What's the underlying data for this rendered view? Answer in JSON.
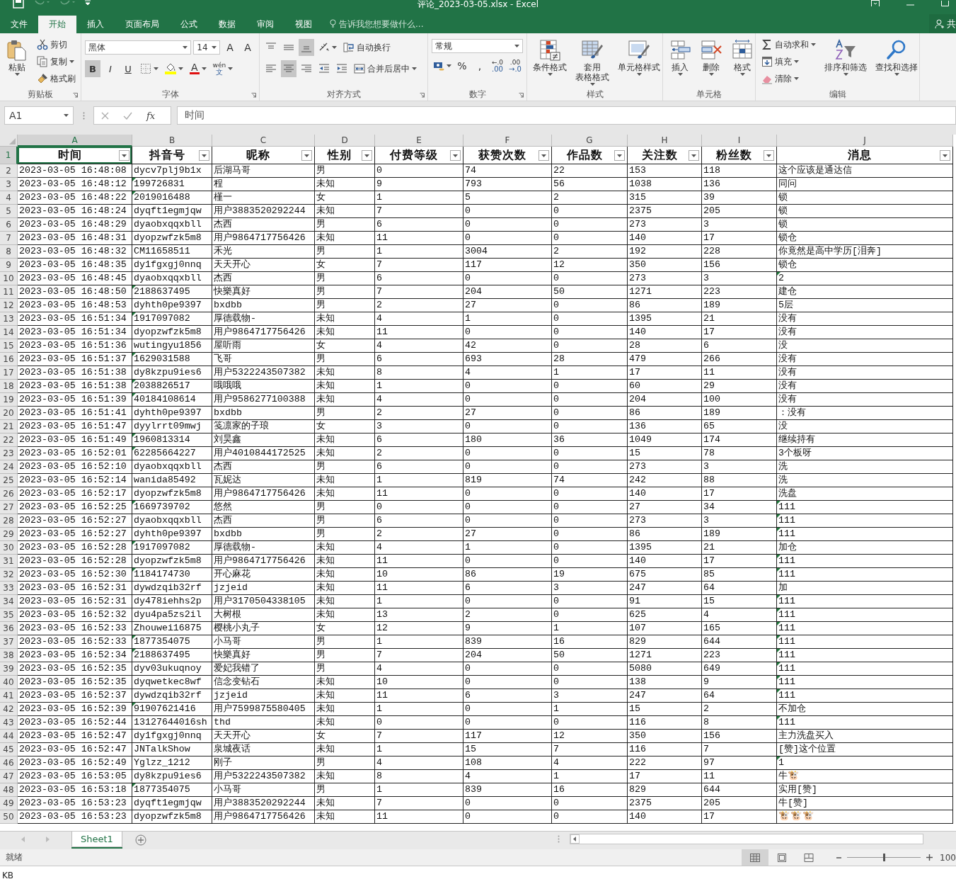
{
  "title_bar": {
    "title": "评论_2023-03-05.xlsx - Excel"
  },
  "ribbon_tabs": [
    {
      "label": "文件",
      "selected": false
    },
    {
      "label": "开始",
      "selected": true
    },
    {
      "label": "插入",
      "selected": false
    },
    {
      "label": "页面布局",
      "selected": false
    },
    {
      "label": "公式",
      "selected": false
    },
    {
      "label": "数据",
      "selected": false
    },
    {
      "label": "审阅",
      "selected": false
    },
    {
      "label": "视图",
      "selected": false
    }
  ],
  "tell_me": {
    "placeholder": "告诉我您想要做什么..."
  },
  "share": "共",
  "ribbon": {
    "groups": [
      {
        "label": "剪贴板",
        "launcher": true,
        "columns": [
          [
            {
              "kind": "large",
              "label": "粘贴",
              "dropdown": true
            }
          ],
          [
            {
              "kind": "small",
              "label": "剪切",
              "dropdown": false
            },
            {
              "kind": "small",
              "label": "复制",
              "dropdown": true
            },
            {
              "kind": "small",
              "label": "格式刷",
              "dropdown": false
            }
          ]
        ]
      },
      {
        "label": "字体",
        "launcher": true,
        "rows": [
          [
            {
              "kind": "combo",
              "value": "黑体"
            },
            {
              "kind": "combo",
              "value": "14"
            },
            {
              "kind": "glyph",
              "label": "A",
              "dropdown": false
            },
            {
              "kind": "glyph",
              "label": "A",
              "dropdown": false
            }
          ],
          [
            {
              "kind": "toggle",
              "label": "B",
              "on": true
            },
            {
              "kind": "toggle",
              "label": "I",
              "on": false
            },
            {
              "kind": "toggle",
              "label": "U",
              "on": false
            },
            {
              "kind": "icon",
              "dropdown": true,
              "on": false
            },
            {
              "kind": "icon",
              "dropdown": true,
              "on": false
            },
            {
              "kind": "color_glyph",
              "label": "A",
              "dropdown": true
            },
            {
              "kind": "stack",
              "top": "wén",
              "label": "文",
              "dropdown": true
            }
          ]
        ]
      },
      {
        "label": "对齐方式",
        "launcher": true,
        "rows": [
          [
            {
              "kind": "icon",
              "dropdown": false,
              "on": false
            },
            {
              "kind": "icon",
              "dropdown": false,
              "on": false
            },
            {
              "kind": "icon",
              "dropdown": false,
              "on": true
            },
            {
              "kind": "icon",
              "dropdown": true,
              "on": false
            },
            {
              "kind": "small",
              "label": "自动换行",
              "dropdown": false
            }
          ],
          [
            {
              "kind": "icon",
              "dropdown": false,
              "on": false
            },
            {
              "kind": "icon",
              "dropdown": false,
              "on": true
            },
            {
              "kind": "icon",
              "dropdown": false,
              "on": false
            },
            {
              "kind": "icon",
              "dropdown": false,
              "on": false
            },
            {
              "kind": "icon",
              "dropdown": false,
              "on": false
            },
            {
              "kind": "small",
              "label": "合并后居中",
              "dropdown": true
            }
          ]
        ]
      },
      {
        "label": "数字",
        "launcher": true,
        "rows": [
          [
            {
              "kind": "combo",
              "value": "常规"
            }
          ],
          [
            {
              "kind": "icon",
              "dropdown": true,
              "on": false
            },
            {
              "kind": "glyph",
              "label": "%",
              "dropdown": false
            },
            {
              "kind": "glyph",
              "label": ",",
              "dropdown": false
            },
            {
              "kind": "stack",
              "top": "←.0",
              "label": ".00",
              "dropdown": false
            },
            {
              "kind": "stack",
              "top": ".00",
              "label": "→.0",
              "dropdown": false
            }
          ]
        ]
      },
      {
        "label": "样式",
        "launcher": false,
        "columns": [
          [
            {
              "kind": "large",
              "label": "条件格式",
              "dropdown": true
            }
          ],
          [
            {
              "kind": "large",
              "lines": [
                "套用",
                "表格格式"
              ],
              "dropdown": true
            }
          ],
          [
            {
              "kind": "large",
              "label": "单元格样式",
              "dropdown": true
            }
          ]
        ]
      },
      {
        "label": "单元格",
        "launcher": false,
        "columns": [
          [
            {
              "kind": "large",
              "label": "插入",
              "dropdown": true
            }
          ],
          [
            {
              "kind": "large",
              "label": "删除",
              "dropdown": true
            }
          ],
          [
            {
              "kind": "large",
              "label": "格式",
              "dropdown": true
            }
          ]
        ]
      },
      {
        "label": "编辑",
        "launcher": false,
        "columns": [
          [
            {
              "kind": "small",
              "label": "自动求和",
              "dropdown": true
            },
            {
              "kind": "small",
              "label": "填充",
              "dropdown": true
            },
            {
              "kind": "small",
              "label": "清除",
              "dropdown": true
            }
          ],
          [
            {
              "kind": "large",
              "label": "排序和筛选",
              "dropdown": true
            }
          ],
          [
            {
              "kind": "large",
              "label": "查找和选择",
              "dropdown": true
            }
          ]
        ]
      }
    ]
  },
  "formula_bar": {
    "name_box": "A1",
    "function_label": "fx",
    "formula": "时间"
  },
  "sheet": {
    "columns": [
      {
        "letter": "A",
        "selected": true
      },
      {
        "letter": "B",
        "selected": false
      },
      {
        "letter": "C",
        "selected": false
      },
      {
        "letter": "D",
        "selected": false
      },
      {
        "letter": "E",
        "selected": false
      },
      {
        "letter": "F",
        "selected": false
      },
      {
        "letter": "G",
        "selected": false
      },
      {
        "letter": "H",
        "selected": false
      },
      {
        "letter": "I",
        "selected": false
      },
      {
        "letter": "J",
        "selected": false
      }
    ],
    "header_row": {
      "number": "1",
      "selected": true,
      "headers": [
        "时间",
        "抖音号",
        "昵称",
        "性别",
        "付费等级",
        "获赞次数",
        "作品数",
        "关注数",
        "粉丝数",
        "消息"
      ]
    },
    "rows": [
      {
        "number": "2",
        "cells": [
          "2023-03-05 16:48:08",
          "dycv7plj9b1x",
          "后湖马哥",
          "男",
          "0",
          "74",
          "22",
          "153",
          "118",
          "这个应该是通达信"
        ],
        "flag_b": false,
        "flag_j": false
      },
      {
        "number": "3",
        "cells": [
          "2023-03-05 16:48:12",
          "199726831",
          "程",
          "未知",
          "9",
          "793",
          "56",
          "1038",
          "136",
          "同问"
        ],
        "flag_b": true,
        "flag_j": false
      },
      {
        "number": "4",
        "cells": [
          "2023-03-05 16:48:22",
          "2019016488",
          "槿一",
          "女",
          "1",
          "5",
          "2",
          "315",
          "39",
          "锁"
        ],
        "flag_b": true,
        "flag_j": false
      },
      {
        "number": "5",
        "cells": [
          "2023-03-05 16:48:24",
          "dyqft1egmjqw",
          "用户3883520292244",
          "未知",
          "7",
          "0",
          "0",
          "2375",
          "205",
          "锁"
        ],
        "flag_b": false,
        "flag_j": false
      },
      {
        "number": "6",
        "cells": [
          "2023-03-05 16:48:29",
          "dyaobxqqxbll",
          "杰西",
          "男",
          "6",
          "0",
          "0",
          "273",
          "3",
          "锁"
        ],
        "flag_b": false,
        "flag_j": false
      },
      {
        "number": "7",
        "cells": [
          "2023-03-05 16:48:31",
          "dyopzwfzk5m8",
          "用户9864717756426",
          "未知",
          "11",
          "0",
          "0",
          "140",
          "17",
          "锁仓"
        ],
        "flag_b": false,
        "flag_j": false
      },
      {
        "number": "8",
        "cells": [
          "2023-03-05 16:48:32",
          "CM11658511",
          "禾光",
          "男",
          "1",
          "3004",
          "2",
          "192",
          "228",
          "你竟然是高中学历[泪奔]"
        ],
        "flag_b": false,
        "flag_j": false
      },
      {
        "number": "9",
        "cells": [
          "2023-03-05 16:48:35",
          "dy1fgxgj0nnq",
          "天天开心",
          "女",
          "7",
          "117",
          "12",
          "350",
          "156",
          "锁仓"
        ],
        "flag_b": false,
        "flag_j": false
      },
      {
        "number": "10",
        "cells": [
          "2023-03-05 16:48:45",
          "dyaobxqqxbll",
          "杰西",
          "男",
          "6",
          "0",
          "0",
          "273",
          "3",
          "2"
        ],
        "flag_b": false,
        "flag_j": true
      },
      {
        "number": "11",
        "cells": [
          "2023-03-05 16:48:50",
          "2188637495",
          "快樂真好",
          "男",
          "7",
          "204",
          "50",
          "1271",
          "223",
          "建仓"
        ],
        "flag_b": true,
        "flag_j": false
      },
      {
        "number": "12",
        "cells": [
          "2023-03-05 16:48:53",
          "dyhth0pe9397",
          "bxdbb",
          "男",
          "2",
          "27",
          "0",
          "86",
          "189",
          "5层"
        ],
        "flag_b": false,
        "flag_j": false
      },
      {
        "number": "13",
        "cells": [
          "2023-03-05 16:51:34",
          "1917097082",
          "厚德载物-",
          "未知",
          "4",
          "1",
          "0",
          "1395",
          "21",
          "没有"
        ],
        "flag_b": true,
        "flag_j": false
      },
      {
        "number": "14",
        "cells": [
          "2023-03-05 16:51:34",
          "dyopzwfzk5m8",
          "用户9864717756426",
          "未知",
          "11",
          "0",
          "0",
          "140",
          "17",
          "没有"
        ],
        "flag_b": false,
        "flag_j": false
      },
      {
        "number": "15",
        "cells": [
          "2023-03-05 16:51:36",
          "wutingyu1856",
          "屋听雨",
          "女",
          "4",
          "42",
          "0",
          "28",
          "6",
          "没"
        ],
        "flag_b": false,
        "flag_j": false
      },
      {
        "number": "16",
        "cells": [
          "2023-03-05 16:51:37",
          "1629031588",
          "飞哥",
          "男",
          "6",
          "693",
          "28",
          "479",
          "266",
          "没有"
        ],
        "flag_b": true,
        "flag_j": false
      },
      {
        "number": "17",
        "cells": [
          "2023-03-05 16:51:38",
          "dy8kzpu9ies6",
          "用户5322243507382",
          "未知",
          "8",
          "4",
          "1",
          "17",
          "11",
          "没有"
        ],
        "flag_b": false,
        "flag_j": false
      },
      {
        "number": "18",
        "cells": [
          "2023-03-05 16:51:38",
          "2038826517",
          "哦哦哦",
          "未知",
          "1",
          "0",
          "0",
          "60",
          "29",
          "没有"
        ],
        "flag_b": true,
        "flag_j": false
      },
      {
        "number": "19",
        "cells": [
          "2023-03-05 16:51:39",
          "40184108614",
          "用户9586277100388",
          "未知",
          "4",
          "0",
          "0",
          "204",
          "100",
          "没有"
        ],
        "flag_b": true,
        "flag_j": false
      },
      {
        "number": "20",
        "cells": [
          "2023-03-05 16:51:41",
          "dyhth0pe9397",
          "bxdbb",
          "男",
          "2",
          "27",
          "0",
          "86",
          "189",
          "：没有"
        ],
        "flag_b": false,
        "flag_j": false
      },
      {
        "number": "21",
        "cells": [
          "2023-03-05 16:51:47",
          "dyylrrt09mwj",
          "笺凛家的子琅",
          "女",
          "3",
          "0",
          "0",
          "136",
          "65",
          "没"
        ],
        "flag_b": false,
        "flag_j": false
      },
      {
        "number": "22",
        "cells": [
          "2023-03-05 16:51:49",
          "1960813314",
          "刘昊鑫",
          "未知",
          "6",
          "180",
          "36",
          "1049",
          "174",
          "继续持有"
        ],
        "flag_b": true,
        "flag_j": false
      },
      {
        "number": "23",
        "cells": [
          "2023-03-05 16:52:01",
          "62285664227",
          "用户4010844172525",
          "未知",
          "2",
          "0",
          "0",
          "15",
          "78",
          "3个板呀"
        ],
        "flag_b": true,
        "flag_j": false
      },
      {
        "number": "24",
        "cells": [
          "2023-03-05 16:52:10",
          "dyaobxqqxbll",
          "杰西",
          "男",
          "6",
          "0",
          "0",
          "273",
          "3",
          "洗"
        ],
        "flag_b": false,
        "flag_j": false
      },
      {
        "number": "25",
        "cells": [
          "2023-03-05 16:52:14",
          "wanida85492",
          "瓦妮达",
          "未知",
          "1",
          "819",
          "74",
          "242",
          "88",
          "洗"
        ],
        "flag_b": false,
        "flag_j": false
      },
      {
        "number": "26",
        "cells": [
          "2023-03-05 16:52:17",
          "dyopzwfzk5m8",
          "用户9864717756426",
          "未知",
          "11",
          "0",
          "0",
          "140",
          "17",
          "洗盘"
        ],
        "flag_b": false,
        "flag_j": false
      },
      {
        "number": "27",
        "cells": [
          "2023-03-05 16:52:25",
          "1669739702",
          "悠然",
          "男",
          "0",
          "0",
          "0",
          "27",
          "34",
          "111"
        ],
        "flag_b": true,
        "flag_j": true
      },
      {
        "number": "28",
        "cells": [
          "2023-03-05 16:52:27",
          "dyaobxqqxbll",
          "杰西",
          "男",
          "6",
          "0",
          "0",
          "273",
          "3",
          "111"
        ],
        "flag_b": false,
        "flag_j": true
      },
      {
        "number": "29",
        "cells": [
          "2023-03-05 16:52:27",
          "dyhth0pe9397",
          "bxdbb",
          "男",
          "2",
          "27",
          "0",
          "86",
          "189",
          "111"
        ],
        "flag_b": false,
        "flag_j": true
      },
      {
        "number": "30",
        "cells": [
          "2023-03-05 16:52:28",
          "1917097082",
          "厚德载物-",
          "未知",
          "4",
          "1",
          "0",
          "1395",
          "21",
          "加仓"
        ],
        "flag_b": true,
        "flag_j": false
      },
      {
        "number": "31",
        "cells": [
          "2023-03-05 16:52:28",
          "dyopzwfzk5m8",
          "用户9864717756426",
          "未知",
          "11",
          "0",
          "0",
          "140",
          "17",
          "111"
        ],
        "flag_b": false,
        "flag_j": true
      },
      {
        "number": "32",
        "cells": [
          "2023-03-05 16:52:30",
          "1184174730",
          "开心麻花",
          "未知",
          "10",
          "86",
          "19",
          "675",
          "85",
          "111"
        ],
        "flag_b": true,
        "flag_j": true
      },
      {
        "number": "33",
        "cells": [
          "2023-03-05 16:52:31",
          "dywdzqib32rf",
          "jzjeid",
          "未知",
          "11",
          "6",
          "3",
          "247",
          "64",
          "加"
        ],
        "flag_b": false,
        "flag_j": false
      },
      {
        "number": "34",
        "cells": [
          "2023-03-05 16:52:31",
          "dy478iehhs2p",
          "用户3170504338105",
          "未知",
          "1",
          "0",
          "0",
          "91",
          "15",
          "111"
        ],
        "flag_b": false,
        "flag_j": true
      },
      {
        "number": "35",
        "cells": [
          "2023-03-05 16:52:32",
          "dyu4pa5zs2il",
          "大树根",
          "未知",
          "13",
          "2",
          "0",
          "625",
          "4",
          "111"
        ],
        "flag_b": false,
        "flag_j": true
      },
      {
        "number": "36",
        "cells": [
          "2023-03-05 16:52:33",
          "Zhouwei16875",
          "樱桃小丸子",
          "女",
          "12",
          "9",
          "1",
          "107",
          "165",
          "111"
        ],
        "flag_b": false,
        "flag_j": true
      },
      {
        "number": "37",
        "cells": [
          "2023-03-05 16:52:33",
          "1877354075",
          "小马哥",
          "男",
          "1",
          "839",
          "16",
          "829",
          "644",
          "111"
        ],
        "flag_b": true,
        "flag_j": true
      },
      {
        "number": "38",
        "cells": [
          "2023-03-05 16:52:34",
          "2188637495",
          "快樂真好",
          "男",
          "7",
          "204",
          "50",
          "1271",
          "223",
          "111"
        ],
        "flag_b": true,
        "flag_j": true
      },
      {
        "number": "39",
        "cells": [
          "2023-03-05 16:52:35",
          "dyv03ukuqnoy",
          "爱妃我错了",
          "男",
          "4",
          "0",
          "0",
          "5080",
          "649",
          "111"
        ],
        "flag_b": false,
        "flag_j": true
      },
      {
        "number": "40",
        "cells": [
          "2023-03-05 16:52:35",
          "dyqwetkec8wf",
          "信念变钻石",
          "未知",
          "10",
          "0",
          "0",
          "138",
          "9",
          "111"
        ],
        "flag_b": false,
        "flag_j": true
      },
      {
        "number": "41",
        "cells": [
          "2023-03-05 16:52:37",
          "dywdzqib32rf",
          "jzjeid",
          "未知",
          "11",
          "6",
          "3",
          "247",
          "64",
          "111"
        ],
        "flag_b": false,
        "flag_j": true
      },
      {
        "number": "42",
        "cells": [
          "2023-03-05 16:52:39",
          "91907621416",
          "用户7599875580405",
          "未知",
          "1",
          "0",
          "1",
          "15",
          "2",
          "不加仓"
        ],
        "flag_b": true,
        "flag_j": false
      },
      {
        "number": "43",
        "cells": [
          "2023-03-05 16:52:44",
          "13127644016sh",
          "thd",
          "未知",
          "0",
          "0",
          "0",
          "116",
          "8",
          "111"
        ],
        "flag_b": false,
        "flag_j": true
      },
      {
        "number": "44",
        "cells": [
          "2023-03-05 16:52:47",
          "dy1fgxgj0nnq",
          "天天开心",
          "女",
          "7",
          "117",
          "12",
          "350",
          "156",
          "主力洗盘买入"
        ],
        "flag_b": false,
        "flag_j": false
      },
      {
        "number": "45",
        "cells": [
          "2023-03-05 16:52:47",
          "JNTalkShow",
          "泉城夜话",
          "未知",
          "1",
          "15",
          "7",
          "116",
          "7",
          "[赞]这个位置"
        ],
        "flag_b": false,
        "flag_j": false
      },
      {
        "number": "46",
        "cells": [
          "2023-03-05 16:52:49",
          "Yglzz_1212",
          "刚子",
          "男",
          "4",
          "108",
          "4",
          "222",
          "97",
          "1"
        ],
        "flag_b": false,
        "flag_j": true
      },
      {
        "number": "47",
        "cells": [
          "2023-03-05 16:53:05",
          "dy8kzpu9ies6",
          "用户5322243507382",
          "未知",
          "8",
          "4",
          "1",
          "17",
          "11",
          "牛🐮"
        ],
        "flag_b": false,
        "flag_j": false
      },
      {
        "number": "48",
        "cells": [
          "2023-03-05 16:53:18",
          "1877354075",
          "小马哥",
          "男",
          "1",
          "839",
          "16",
          "829",
          "644",
          "实用[赞]"
        ],
        "flag_b": true,
        "flag_j": false
      },
      {
        "number": "49",
        "cells": [
          "2023-03-05 16:53:23",
          "dyqft1egmjqw",
          "用户3883520292244",
          "未知",
          "7",
          "0",
          "0",
          "2375",
          "205",
          "牛[赞]"
        ],
        "flag_b": false,
        "flag_j": false
      },
      {
        "number": "50",
        "cells": [
          "2023-03-05 16:53:23",
          "dyopzwfzk5m8",
          "用户9864717756426",
          "未知",
          "11",
          "0",
          "0",
          "140",
          "17",
          "🐮🐮🐮"
        ],
        "flag_b": false,
        "flag_j": false
      }
    ]
  },
  "sheet_tabs": [
    {
      "label": "Sheet1",
      "selected": true
    }
  ],
  "status_bar": {
    "text": "就绪",
    "views": [
      {
        "selected": true
      },
      {
        "selected": false
      },
      {
        "selected": false
      }
    ],
    "zoom_slider": {
      "level": 0.5
    },
    "zoom": "100"
  },
  "taskbar_fragment": "KB"
}
